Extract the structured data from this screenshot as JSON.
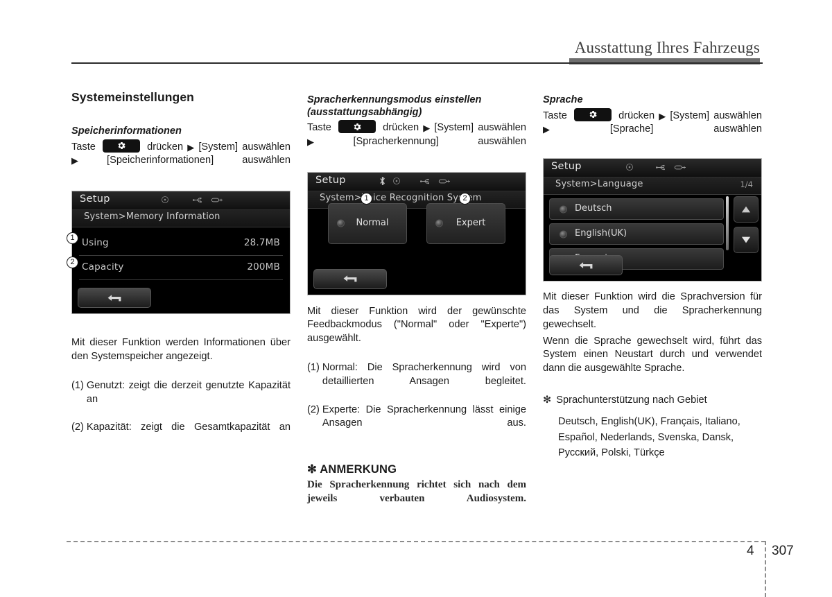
{
  "header": {
    "title": "Ausstattung Ihres Fahrzeugs"
  },
  "footer": {
    "chapter": "4",
    "page": "307"
  },
  "columns": {
    "left": {
      "section_title": "Systemeinstellungen",
      "sub_title": "Speicherinformationen",
      "steps": {
        "pre": "Taste",
        "press": "drücken",
        "item1": "[System]",
        "select1": "auswählen",
        "item2": "[Speicherinformationen]",
        "select2": "auswählen"
      },
      "screen": {
        "title": "Setup",
        "path": "System>Memory Information",
        "rows": [
          {
            "marker": "1",
            "label": "Using",
            "value": "28.7MB"
          },
          {
            "marker": "2",
            "label": "Capacity",
            "value": "200MB"
          }
        ],
        "back_label": "back-arrow"
      },
      "description": "Mit dieser Funktion werden Informationen über den Systemspeicher angezeigt.",
      "list": [
        {
          "idx": "(1)",
          "text": "Genutzt: zeigt die derzeit genutzte Kapazität an"
        },
        {
          "idx": "(2)",
          "text": "Kapazität: zeigt die Gesamtkapazität an"
        }
      ]
    },
    "middle": {
      "sub_title_line1": "Spracherkennungsmodus einstellen",
      "sub_title_line2": "(ausstattungsabhängig)",
      "steps": {
        "pre": "Taste",
        "press": "drücken",
        "item1": "[System]",
        "select1": "auswählen",
        "item2": "[Spracherkennung]",
        "select2": "auswählen"
      },
      "screen": {
        "title": "Setup",
        "path": "System>Voice Recognition System",
        "buttons": [
          {
            "marker": "1",
            "label": "Normal"
          },
          {
            "marker": "2",
            "label": "Expert"
          }
        ],
        "back_label": "back-arrow"
      },
      "description": "Mit dieser Funktion wird der gewünschte Feedbackmodus (\"Normal\" oder \"Experte\") ausgewählt.",
      "list": [
        {
          "idx": "(1)",
          "text": "Normal: Die Spracherkennung wird von detaillierten Ansagen begleitet."
        },
        {
          "idx": "(2)",
          "text": "Experte: Die Spracherkennung lässt einige Ansagen aus."
        }
      ],
      "note": {
        "symbol": "✻",
        "title": "ANMERKUNG",
        "body": "Die Spracherkennung richtet sich nach dem jeweils verbauten Audiosystem."
      }
    },
    "right": {
      "sub_title": "Sprache",
      "steps": {
        "pre": "Taste",
        "press": "drücken",
        "item1": "[System]",
        "select1": "auswählen",
        "item2": "[Sprache]",
        "select2": "auswählen"
      },
      "screen": {
        "title": "Setup",
        "path": "System>Language",
        "page_indicator": "1/4",
        "languages": [
          "Deutsch",
          "English(UK)",
          "Français"
        ],
        "back_label": "back-arrow"
      },
      "description_1": "Mit dieser Funktion wird die Sprachversion für das System und die Spracherkennung gewechselt.",
      "description_2": "Wenn die Sprache gewechselt wird, führt das System einen Neustart durch und verwendet dann die ausgewählte Sprache.",
      "support": {
        "symbol": "✻",
        "title": "Sprachunterstützung nach Gebiet",
        "languages": "Deutsch, English(UK), Français, Italiano, Español, Nederlands, Svenska, Dansk, Русский, Polski, Türkçe"
      }
    }
  },
  "colors": {
    "header_bar": "#6e6e6e",
    "text": "#1a1a1a",
    "screen_bg": "#000000"
  }
}
